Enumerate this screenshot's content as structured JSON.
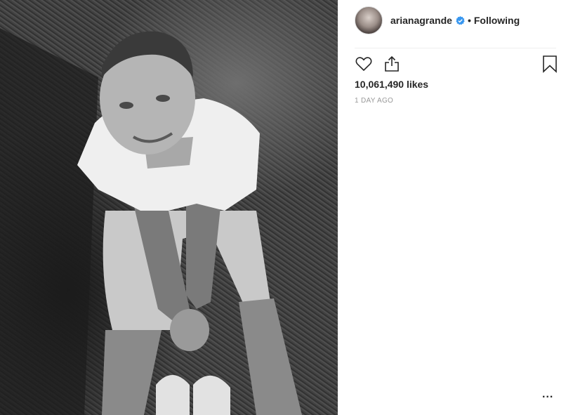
{
  "post": {
    "image_alt": "Black and white photo of a man in a white t-shirt sitting on grass"
  },
  "header": {
    "username": "arianagrande",
    "separator": "•",
    "follow_status": "Following",
    "verified_icon": "verified-badge-icon",
    "accent": "#3897f0"
  },
  "actions": {
    "like_icon": "heart-icon",
    "share_icon": "share-icon",
    "save_icon": "bookmark-icon"
  },
  "stats": {
    "likes": "10,061,490 likes",
    "posted": "1 DAY AGO"
  },
  "footer": {
    "more": "..."
  }
}
